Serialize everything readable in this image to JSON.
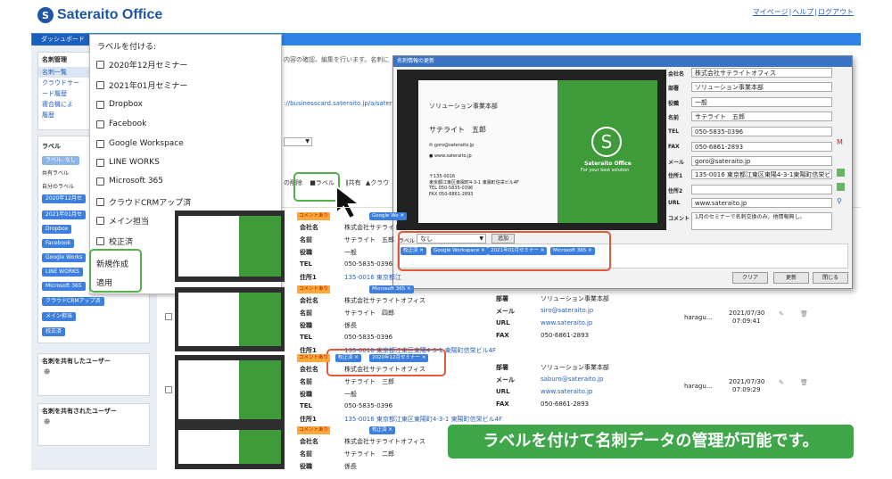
{
  "header": {
    "logo_text": "Sateraito Office",
    "links": [
      "マイページ",
      "ヘルプ",
      "ログアウト"
    ]
  },
  "nav": {
    "dashboard": "ダッシュボード"
  },
  "sidebar": {
    "mgmt_title": "名刺管理",
    "mgmt_items": [
      "名刺一覧",
      "クラウドサー",
      "ード履歴",
      "複合機によ",
      "履歴"
    ],
    "label_title": "ラベル",
    "label_none": "ラベル: なし",
    "shared_label": "共有ラベル",
    "own_label": "自分のラベル",
    "chips": [
      "2020年12月セ",
      "2021年01月セ",
      "Dropbox",
      "Facebook",
      "Google Works",
      "LINE WORKS",
      "Microsoft 365",
      "クラウドCRMアップ済",
      "メイン担当",
      "校正済"
    ],
    "shared_users_title": "名刺を共有したユーザー",
    "shared_by_title": "名刺を共有されたユーザー"
  },
  "dropdown": {
    "title": "ラベルを付ける:",
    "items": [
      "2020年12月セミナー",
      "2021年01月セミナー",
      "Dropbox",
      "Facebook",
      "Google Workspace",
      "LINE WORKS",
      "Microsoft 365",
      "クラウドCRMアップ済",
      "メイン担当",
      "校正済"
    ],
    "new_label": "新規作成",
    "apply": "適用"
  },
  "toolbar": {
    "delete": "の削除",
    "label": "ラベル",
    "share": "共有",
    "cloud": "クラウ"
  },
  "notice": "内容の確認、編集を行います。名刺に",
  "url_text": "://businesscard.sateraito.jp/a/sater",
  "rows": [
    {
      "comment": "コメントあり",
      "tags": [
        "Google Wo"
      ],
      "company": "株式会社サテライトオフィ",
      "name": "サテライト　五郎",
      "title": "一般",
      "tel": "050-5835-0396",
      "addr": "135-0016 東京都江"
    },
    {
      "comment": "コメントあり",
      "tags": [
        "Microsoft 365"
      ],
      "company": "株式会社サテライトオフィス",
      "name": "サテライト　四郎",
      "title": "係長",
      "tel": "050-5835-0396",
      "addr": "135-0016 東京都江東区東陽4-3-1 東陽町信栄ビル4F",
      "dept": "ソリューション事業本部",
      "mail": "siro@sateraito.jp",
      "url": "www.sateraito.jp",
      "fax": "050-6861-2893",
      "owner": "haragu...",
      "date": "2021/07/30",
      "time": "07:09:41"
    },
    {
      "comment": "コメントあり",
      "tags": [
        "校正済",
        "2020年12月セミナー"
      ],
      "company": "株式会社サテライトオフィス",
      "name": "サテライト　三郎",
      "title": "一般",
      "tel": "050-5835-0396",
      "addr": "135-0016 東京都江東区東陽町4-3-1 東陽町信栄ビル4F",
      "dept": "ソリューション事業本部",
      "mail": "saburo@sateraito.jp",
      "url": "www.sateraito.jp",
      "fax": "050-6861-2893",
      "owner": "haragu...",
      "date": "2021/07/30",
      "time": "07:09:29"
    },
    {
      "comment": "コメントあり",
      "tags": [
        "校正済"
      ],
      "company": "株式会社サテライトオフィス",
      "name": "サテライト　二郎",
      "title": "係長",
      "tel": "",
      "addr": "",
      "dept": "",
      "mail": "",
      "url": "",
      "fax": "",
      "owner": "",
      "date": "",
      "time": ""
    }
  ],
  "labels": {
    "company": "会社名",
    "name": "名前",
    "title": "役職",
    "tel": "TEL",
    "addr": "住所1",
    "dept": "部署",
    "mail": "メール",
    "url": "URL",
    "fax": "FAX"
  },
  "modal": {
    "title": "名刺情報の更新",
    "card": {
      "dept": "ソリューション事業本部",
      "name": "サテライト　五郎",
      "mail": "goro@sateraito.jp",
      "web": "www.sateraito.jp",
      "zip": "〒135-0016",
      "addr": "東京都江東区東陽町4-3-1 東陽町信栄ビル4F",
      "tel": "TEL 050-5835-0396",
      "fax": "FAX 050-6861-2893",
      "brand": "Sateraito Office",
      "tagline": "For your best solution"
    },
    "label_field": "ラベル",
    "label_value": "なし",
    "add_btn": "追加",
    "label_tags": [
      "校正済",
      "Google Workspace",
      "2021年01月セミナー",
      "Microsoft 365"
    ],
    "fields": [
      {
        "k": "会社名",
        "v": "株式会社サテライトオフィス"
      },
      {
        "k": "部署",
        "v": "ソリューション事業本部"
      },
      {
        "k": "役職",
        "v": "一般"
      },
      {
        "k": "名前",
        "v": "サテライト　五郎"
      },
      {
        "k": "TEL",
        "v": "050-5835-0396"
      },
      {
        "k": "FAX",
        "v": "050-6861-2893"
      },
      {
        "k": "メール",
        "v": "goro@sateraito.jp"
      },
      {
        "k": "住所1",
        "v": "135-0016 東京都江東区東陽4-3-1東陽町信栄ビル4"
      },
      {
        "k": "住所2",
        "v": ""
      },
      {
        "k": "URL",
        "v": "www.sateraito.jp"
      },
      {
        "k": "コメント",
        "v": "1月のセミナーで名刺交換のみ。他情報無し。"
      }
    ],
    "btn_clear": "クリア",
    "btn_update": "更新",
    "btn_close": "閉じる"
  },
  "banner": "ラベルを付けて名刺データの管理が可能です。"
}
